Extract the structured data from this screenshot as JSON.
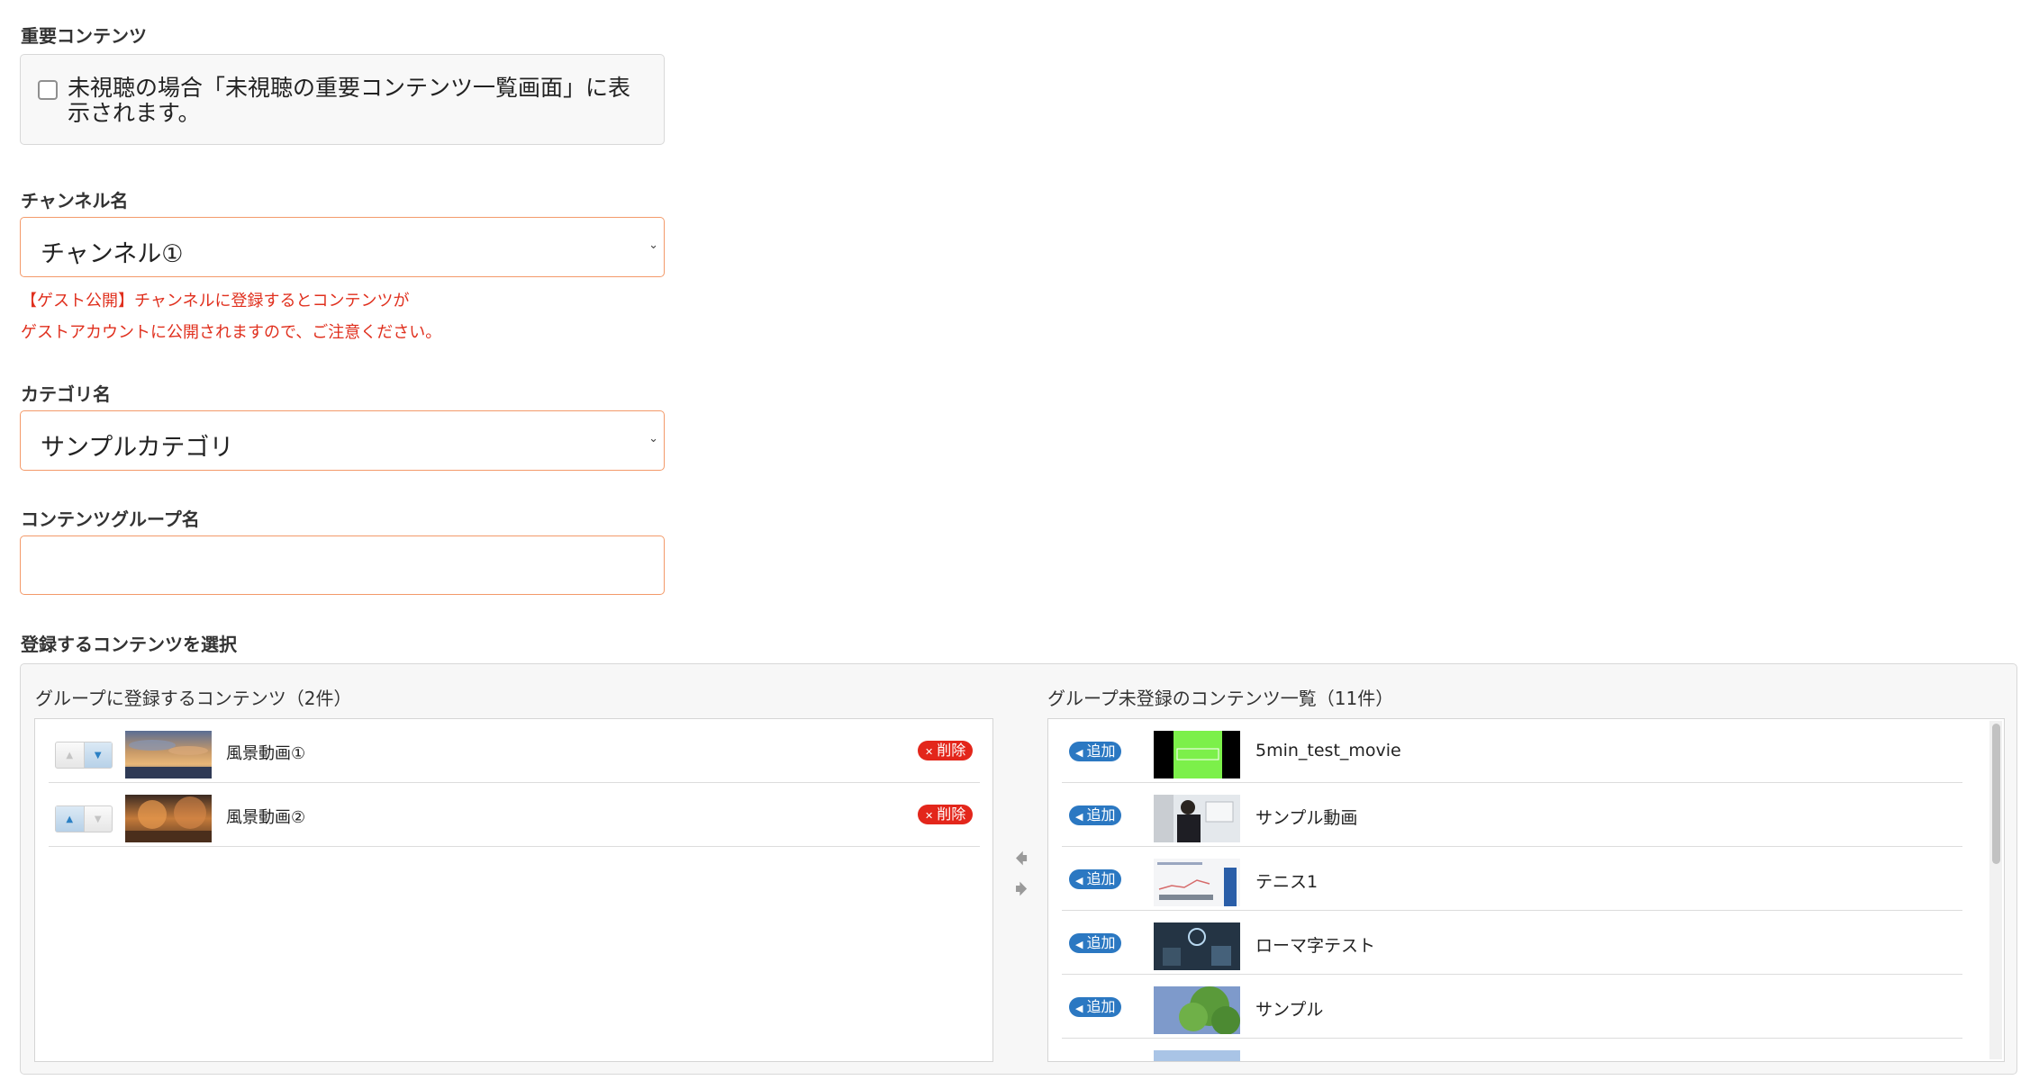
{
  "important": {
    "label": "重要コンテンツ",
    "checkbox_text": "未視聴の場合「未視聴の重要コンテンツ一覧画面」に表示されます。",
    "checked": false
  },
  "channel": {
    "label": "チャンネル名",
    "value": "チャンネル①",
    "warning_line1": "【ゲスト公開】チャンネルに登録するとコンテンツが",
    "warning_line2": "ゲストアカウントに公開されますので、ご注意ください。"
  },
  "category": {
    "label": "カテゴリ名",
    "value": "サンプルカテゴリ"
  },
  "group_name": {
    "label": "コンテンツグループ名",
    "value": ""
  },
  "select_contents": {
    "label": "登録するコンテンツを選択",
    "registered": {
      "title": "グループに登録するコンテンツ（2件）",
      "delete_label": "削除",
      "items": [
        {
          "name": "風景動画①"
        },
        {
          "name": "風景動画②"
        }
      ]
    },
    "unregistered": {
      "title": "グループ未登録のコンテンツ一覧（11件）",
      "add_label": "追加",
      "items": [
        {
          "name": "5min_test_movie"
        },
        {
          "name": "サンプル動画"
        },
        {
          "name": "テニス1"
        },
        {
          "name": "ローマ字テスト"
        },
        {
          "name": "サンプル"
        }
      ]
    }
  },
  "colors": {
    "accent_border": "#f39a6a",
    "warning_text": "#e0301e",
    "delete_badge": "#e3261b",
    "add_badge": "#2b78c2"
  }
}
